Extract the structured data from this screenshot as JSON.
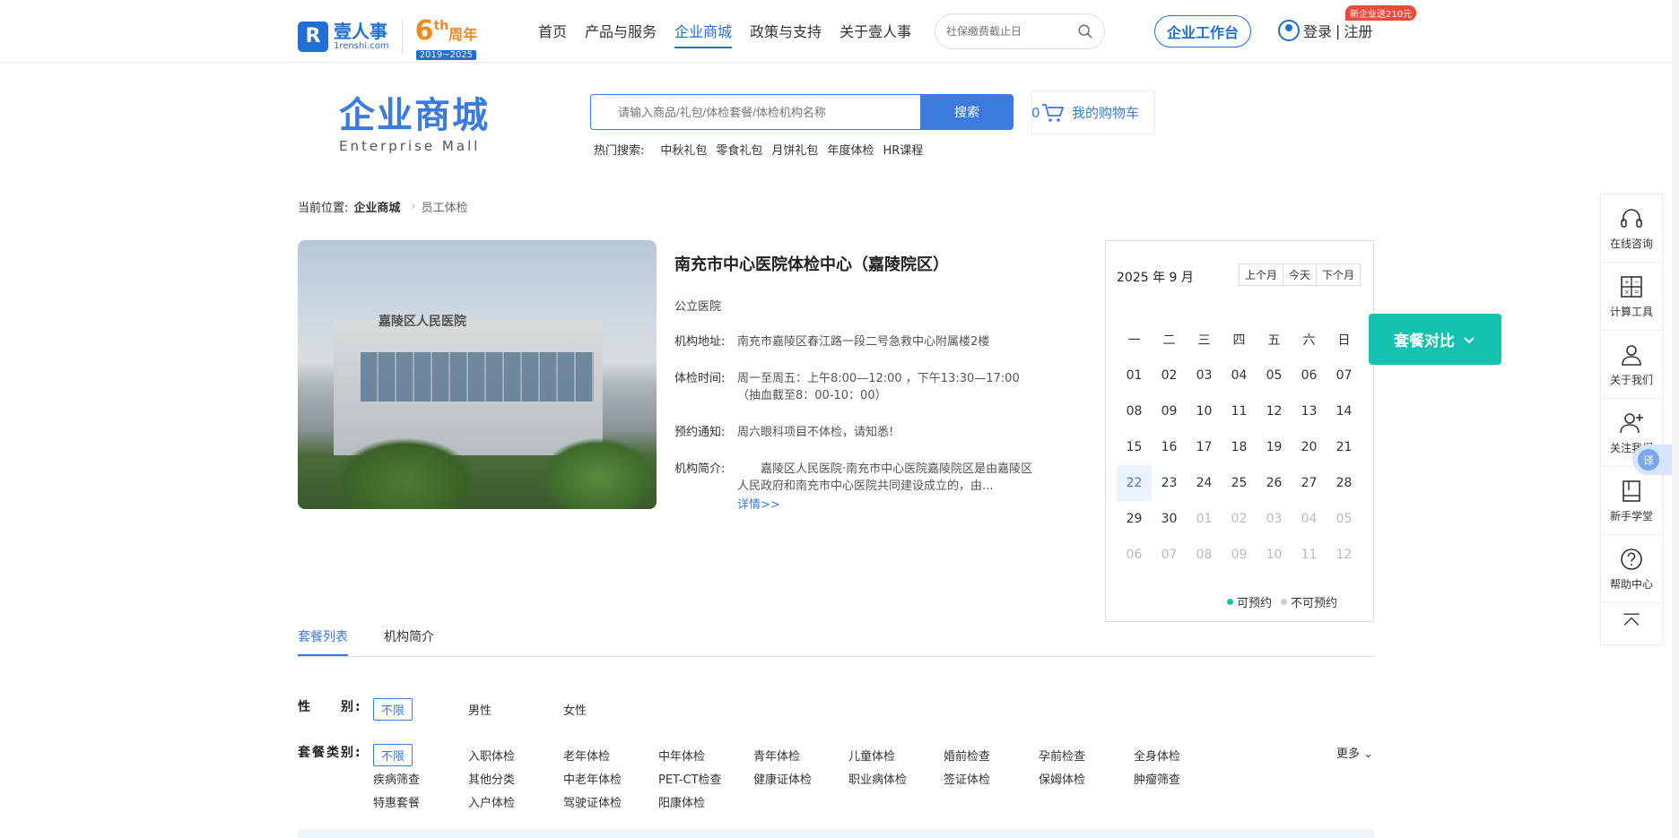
{
  "nav": {
    "logo_name": "壹人事",
    "logo_domain": "1renshi.com",
    "anniversary_num": "6",
    "anniversary_sup": "th",
    "anniversary_suffix": "周年",
    "anniversary_years": "2019~2025",
    "links": [
      "首页",
      "产品与服务",
      "企业商城",
      "政策与支持",
      "关于壹人事"
    ],
    "active_link": "企业商城",
    "search_placeholder": "社保缴费截止日",
    "workbench": "企业工作台",
    "login": "登录",
    "sep": "|",
    "register": "注册",
    "promo": "新企业送210元"
  },
  "mall": {
    "title_cn": "企业商城",
    "title_en": "Enterprise Mall",
    "search_placeholder": "请输入商品/礼包/体检套餐/体检机构名称",
    "search_button": "搜索",
    "cart_label": "我的购物车",
    "cart_count": "0",
    "hot_label": "热门搜索:",
    "hot_items": [
      "中秋礼包",
      "零食礼包",
      "月饼礼包",
      "年度体检",
      "HR课程"
    ]
  },
  "breadcrumb": {
    "prefix": "当前位置:",
    "current": "企业商城",
    "last": "员工体检"
  },
  "institution": {
    "photo_sign": "嘉陵区人民医院",
    "name": "南充市中心医院体检中心（嘉陵院区）",
    "type": "公立医院",
    "address_label": "机构地址:",
    "address": "南充市嘉陵区春江路一段二号急救中心附属楼2楼",
    "hours_label": "体检时间:",
    "hours_line1": "周一至周五：上午8:00—12:00 ，下午13:30—17:00",
    "hours_line2": "（抽血截至8：00-10：00）",
    "notice_label": "预约通知:",
    "notice": "周六眼科项目不体检，请知悉!",
    "intro_label": "机构简介:",
    "intro": "嘉陵区人民医院·南充市中心医院嘉陵院区是由嘉陵区人民政府和南充市中心医院共同建设成立的，由...",
    "more": "详情>>"
  },
  "calendar": {
    "month_label": "2025 年 9 月",
    "prev": "上个月",
    "today": "今天",
    "next": "下个月",
    "weekdays": [
      "一",
      "二",
      "三",
      "四",
      "五",
      "六",
      "日"
    ],
    "days": [
      [
        "01",
        "02",
        "03",
        "04",
        "05",
        "06",
        "07"
      ],
      [
        "08",
        "09",
        "10",
        "11",
        "12",
        "13",
        "14"
      ],
      [
        "15",
        "16",
        "17",
        "18",
        "19",
        "20",
        "21"
      ],
      [
        "22",
        "23",
        "24",
        "25",
        "26",
        "27",
        "28"
      ],
      [
        "29",
        "30",
        "01",
        "02",
        "03",
        "04",
        "05"
      ],
      [
        "06",
        "07",
        "08",
        "09",
        "10",
        "11",
        "12"
      ]
    ],
    "today_day": "22",
    "legend_available": "可预约",
    "legend_unavailable": "不可预约",
    "colors": {
      "available": "#14c2b2",
      "unavailable": "#cccccc"
    }
  },
  "compare_button": "套餐对比",
  "tabs": [
    "套餐列表",
    "机构简介"
  ],
  "active_tab": "套餐列表",
  "filters": {
    "gender_label": "性　　别:",
    "gender_options": [
      "不限",
      "男性",
      "女性"
    ],
    "category_label": "套餐类别:",
    "category_options": [
      "不限",
      "入职体检",
      "老年体检",
      "中年体检",
      "青年体检",
      "儿童体检",
      "婚前检查",
      "孕前检查",
      "全身体检",
      "疾病筛查",
      "其他分类",
      "中老年体检",
      "PET-CT检查",
      "健康证体检",
      "职业病体检",
      "签证体检",
      "保姆体检",
      "肿瘤筛查",
      "特惠套餐",
      "入户体检",
      "驾驶证体检",
      "阳康体检"
    ],
    "more": "更多"
  },
  "rail": [
    "在线咨询",
    "计算工具",
    "关于我们",
    "关注我们",
    "新手学堂",
    "帮助中心"
  ],
  "translate": "译",
  "brand_color": "#1f6fd6",
  "accent_color": "#3b7be0"
}
